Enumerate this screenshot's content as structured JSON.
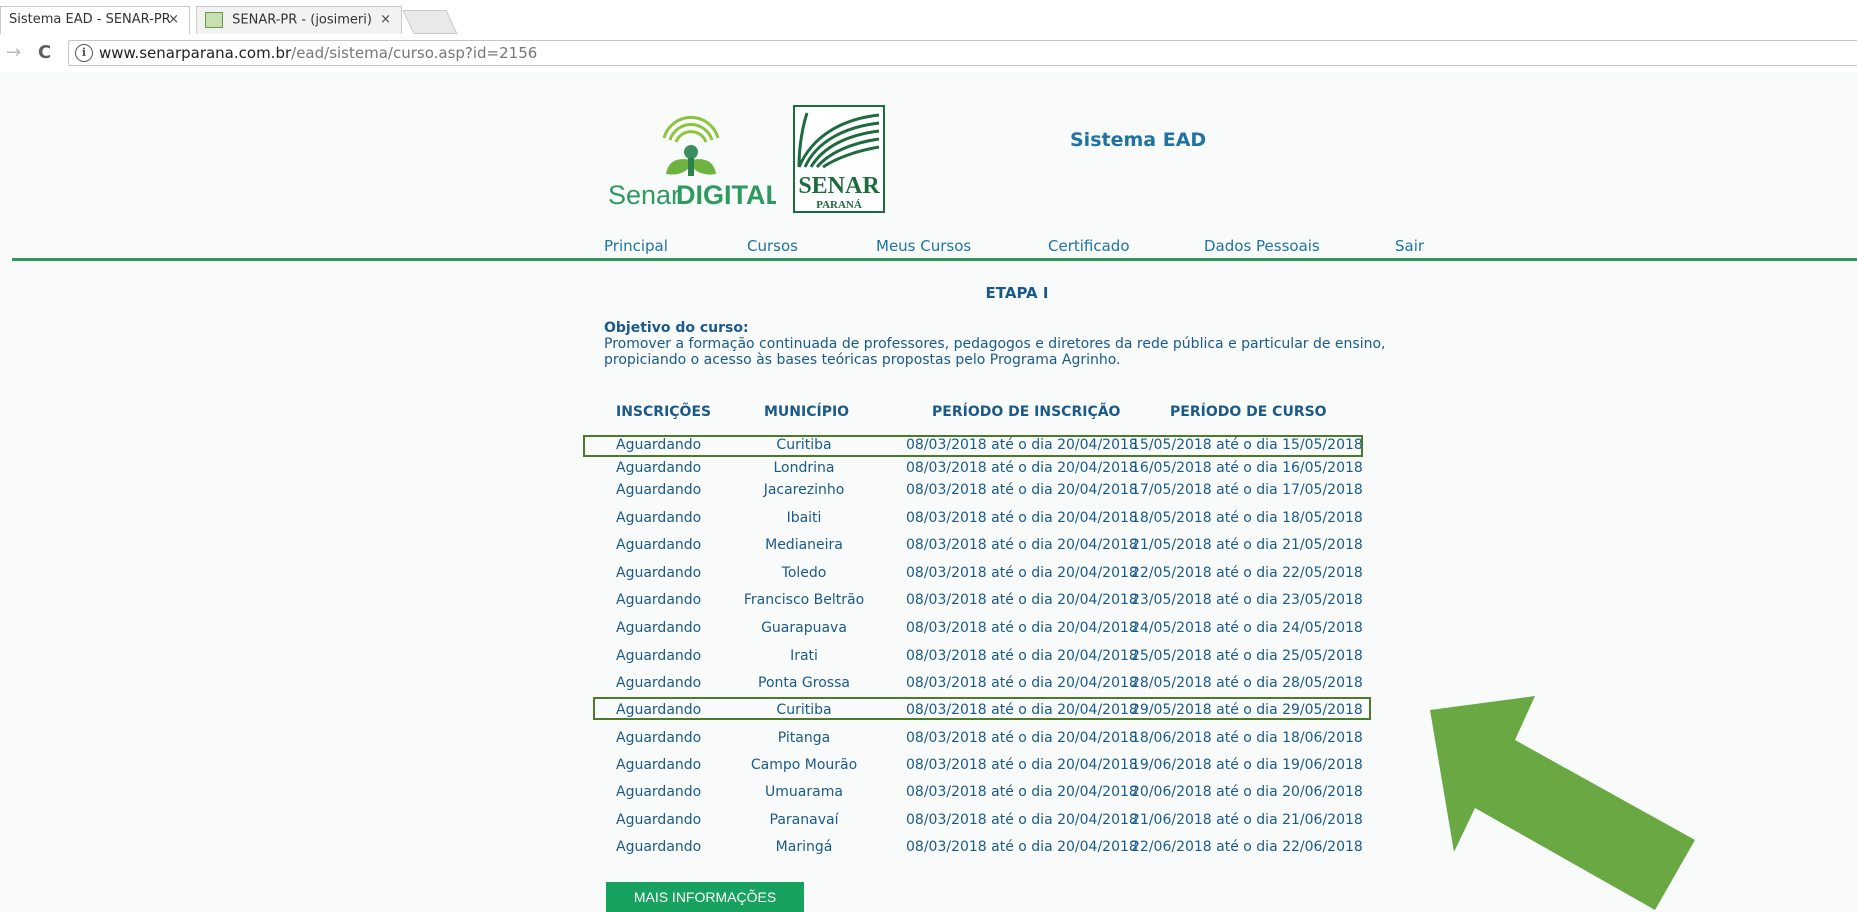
{
  "browser": {
    "tabs": [
      {
        "label": "Sistema EAD - SENAR-PR",
        "close": "×"
      },
      {
        "label": "SENAR-PR - (josimeri)",
        "close": "×"
      }
    ],
    "url_host": "www.senarparana.com.br",
    "url_path": "/ead/sistema/curso.asp?id=2156",
    "back_glyph": "→",
    "reload_glyph": "C",
    "info_glyph": "i"
  },
  "header": {
    "logo_digital_text_a": "Senar",
    "logo_digital_text_b": "DIGITAL",
    "logo_senar_text": "SENAR",
    "logo_parana_text": "PARANÁ",
    "system_title": "Sistema EAD"
  },
  "menu": [
    "Principal",
    "Cursos",
    "Meus Cursos",
    "Certificado",
    "Dados Pessoais",
    "Sair"
  ],
  "course": {
    "stage": "ETAPA I",
    "objective_label": "Objetivo do curso:",
    "objective_text": "Promover a formação continuada de professores, pedagogos e diretores da rede pública e particular de ensino, propiciando o acesso às bases teóricas propostas pelo Programa Agrinho."
  },
  "table": {
    "headers": [
      "INSCRIÇÕES",
      "MUNICÍPIO",
      "PERÍODO DE INSCRIÇÃO",
      "PERÍODO DE CURSO"
    ],
    "rows": [
      [
        "Aguardando",
        "Curitiba",
        "08/03/2018 até o dia 20/04/2018",
        "15/05/2018 até o dia 15/05/2018"
      ],
      [
        "Aguardando",
        "Londrina",
        "08/03/2018 até o dia 20/04/2018",
        "16/05/2018 até o dia 16/05/2018"
      ],
      [
        "Aguardando",
        "Jacarezinho",
        "08/03/2018 até o dia 20/04/2018",
        "17/05/2018 até o dia 17/05/2018"
      ],
      [
        "Aguardando",
        "Ibaiti",
        "08/03/2018 até o dia 20/04/2018",
        "18/05/2018 até o dia 18/05/2018"
      ],
      [
        "Aguardando",
        "Medianeira",
        "08/03/2018 até o dia 20/04/2018",
        "21/05/2018 até o dia 21/05/2018"
      ],
      [
        "Aguardando",
        "Toledo",
        "08/03/2018 até o dia 20/04/2018",
        "22/05/2018 até o dia 22/05/2018"
      ],
      [
        "Aguardando",
        "Francisco Beltrão",
        "08/03/2018 até o dia 20/04/2018",
        "23/05/2018 até o dia 23/05/2018"
      ],
      [
        "Aguardando",
        "Guarapuava",
        "08/03/2018 até o dia 20/04/2018",
        "24/05/2018 até o dia 24/05/2018"
      ],
      [
        "Aguardando",
        "Irati",
        "08/03/2018 até o dia 20/04/2018",
        "25/05/2018 até o dia 25/05/2018"
      ],
      [
        "Aguardando",
        "Ponta Grossa",
        "08/03/2018 até o dia 20/04/2018",
        "28/05/2018 até o dia 28/05/2018"
      ],
      [
        "Aguardando",
        "Curitiba",
        "08/03/2018 até o dia 20/04/2018",
        "29/05/2018 até o dia 29/05/2018"
      ],
      [
        "Aguardando",
        "Pitanga",
        "08/03/2018 até o dia 20/04/2018",
        "18/06/2018 até o dia 18/06/2018"
      ],
      [
        "Aguardando",
        "Campo Mourão",
        "08/03/2018 até o dia 20/04/2018",
        "19/06/2018 até o dia 19/06/2018"
      ],
      [
        "Aguardando",
        "Umuarama",
        "08/03/2018 até o dia 20/04/2018",
        "20/06/2018 até o dia 20/06/2018"
      ],
      [
        "Aguardando",
        "Paranavaí",
        "08/03/2018 até o dia 20/04/2018",
        "21/06/2018 até o dia 21/06/2018"
      ],
      [
        "Aguardando",
        "Maringá",
        "08/03/2018 até o dia 20/04/2018",
        "22/06/2018 até o dia 22/06/2018"
      ]
    ],
    "highlighted_rows": [
      0,
      10
    ]
  },
  "more_info_button": "MAIS INFORMAÇÕES",
  "colors": {
    "accent_green": "#2e9a62",
    "button_green": "#18a25f",
    "text_blue": "#1a5a8a",
    "arrow_green": "#6aa843",
    "highlight_border": "#4a7a2a"
  },
  "icons": {
    "arrow": "arrow-up-left-icon"
  }
}
